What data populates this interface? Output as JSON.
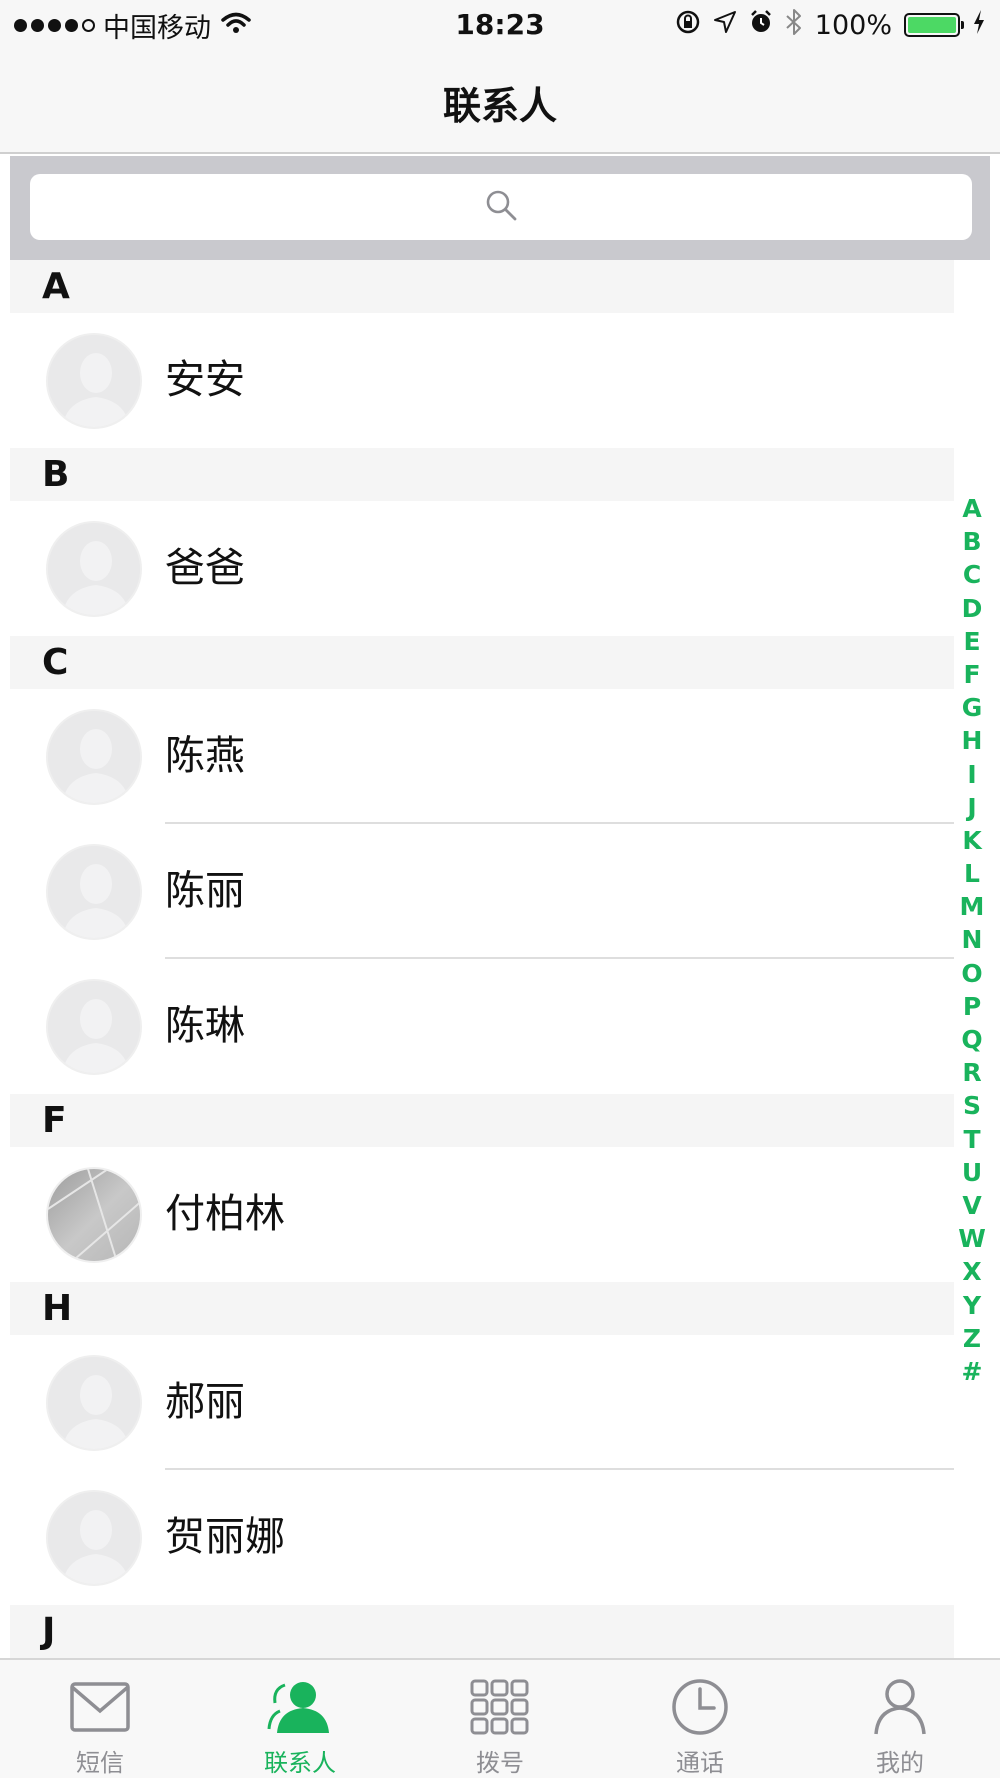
{
  "status_bar": {
    "carrier": "中国移动",
    "time": "18:23",
    "battery_percent": "100%",
    "battery_color": "#4cd964",
    "icons": [
      "signal-dots-icon",
      "wifi-icon",
      "orientation-lock-icon",
      "location-icon",
      "alarm-icon",
      "bluetooth-icon",
      "battery-icon",
      "charging-bolt-icon"
    ]
  },
  "nav": {
    "title": "联系人"
  },
  "search": {
    "icon": "search-icon"
  },
  "sections": [
    {
      "letter": "A",
      "contacts": [
        {
          "name": "安安",
          "avatar": "placeholder"
        }
      ]
    },
    {
      "letter": "B",
      "contacts": [
        {
          "name": "爸爸",
          "avatar": "placeholder"
        }
      ]
    },
    {
      "letter": "C",
      "contacts": [
        {
          "name": "陈燕",
          "avatar": "placeholder"
        },
        {
          "name": "陈丽",
          "avatar": "placeholder"
        },
        {
          "name": "陈琳",
          "avatar": "placeholder"
        }
      ]
    },
    {
      "letter": "F",
      "contacts": [
        {
          "name": "付柏林",
          "avatar": "photo"
        }
      ]
    },
    {
      "letter": "H",
      "contacts": [
        {
          "name": "郝丽",
          "avatar": "placeholder"
        },
        {
          "name": "贺丽娜",
          "avatar": "placeholder"
        }
      ]
    },
    {
      "letter": "J",
      "contacts": []
    }
  ],
  "index": [
    "A",
    "B",
    "C",
    "D",
    "E",
    "F",
    "G",
    "H",
    "I",
    "J",
    "K",
    "L",
    "M",
    "N",
    "O",
    "P",
    "Q",
    "R",
    "S",
    "T",
    "U",
    "V",
    "W",
    "X",
    "Y",
    "Z",
    "#"
  ],
  "accent_color": "#19b35c",
  "tabs": [
    {
      "label": "短信",
      "icon": "envelope-icon",
      "active": false
    },
    {
      "label": "联系人",
      "icon": "contacts-icon",
      "active": true
    },
    {
      "label": "拨号",
      "icon": "dialpad-icon",
      "active": false
    },
    {
      "label": "通话",
      "icon": "clock-icon",
      "active": false
    },
    {
      "label": "我的",
      "icon": "profile-icon",
      "active": false
    }
  ]
}
